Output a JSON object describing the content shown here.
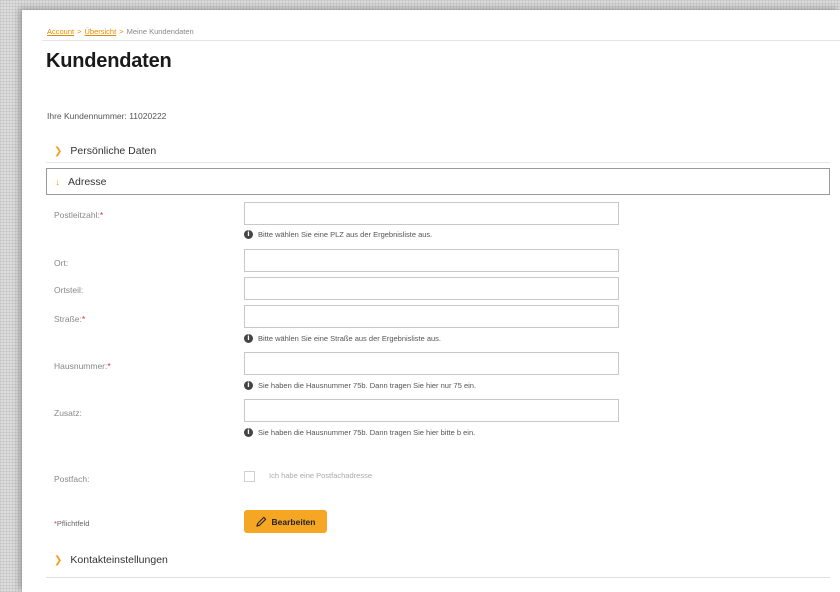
{
  "breadcrumb": {
    "item1": "Account",
    "item2": "Übersicht",
    "item3": "Meine Kundendaten",
    "sep": ">"
  },
  "page_title": "Kundendaten",
  "customer_number": "Ihre Kundennummer:  11020222",
  "sections": {
    "personal": "Persönliche Daten",
    "address": "Adresse",
    "contact": "Kontakteinstellungen"
  },
  "icons": {
    "collapsed": "chevron-right-icon",
    "expanded": "arrow-down-icon",
    "info": "info-icon",
    "edit": "pencil-icon"
  },
  "form": {
    "postleitzahl": {
      "label": "Postleitzahl:",
      "value": "",
      "hint": "Bitte wählen Sie eine PLZ aus der Ergebnisliste aus."
    },
    "ort": {
      "label": "Ort:",
      "value": ""
    },
    "ortsteil": {
      "label": "Ortsteil:",
      "value": ""
    },
    "strasse": {
      "label": "Straße:",
      "value": "",
      "hint": "Bitte wählen Sie eine Straße aus der Ergebnisliste aus."
    },
    "hausnummer": {
      "label": "Hausnummer:",
      "value": "",
      "hint": "Sie haben die Hausnummer 75b. Dann tragen Sie hier nur 75 ein."
    },
    "zusatz": {
      "label": "Zusatz:",
      "value": "",
      "hint": "Sie haben die Hausnummer 75b. Dann tragen Sie hier bitte b ein."
    },
    "postfach": {
      "label": "Postfach:",
      "checkbox_label": "Ich habe eine Postfachadresse",
      "checked": false
    }
  },
  "required_marker": "*",
  "required_note": "Pflichtfeld",
  "edit_button": "Bearbeiten",
  "colors": {
    "accent": "#f5a623",
    "required": "#e0302a",
    "link": "#e08a00"
  }
}
